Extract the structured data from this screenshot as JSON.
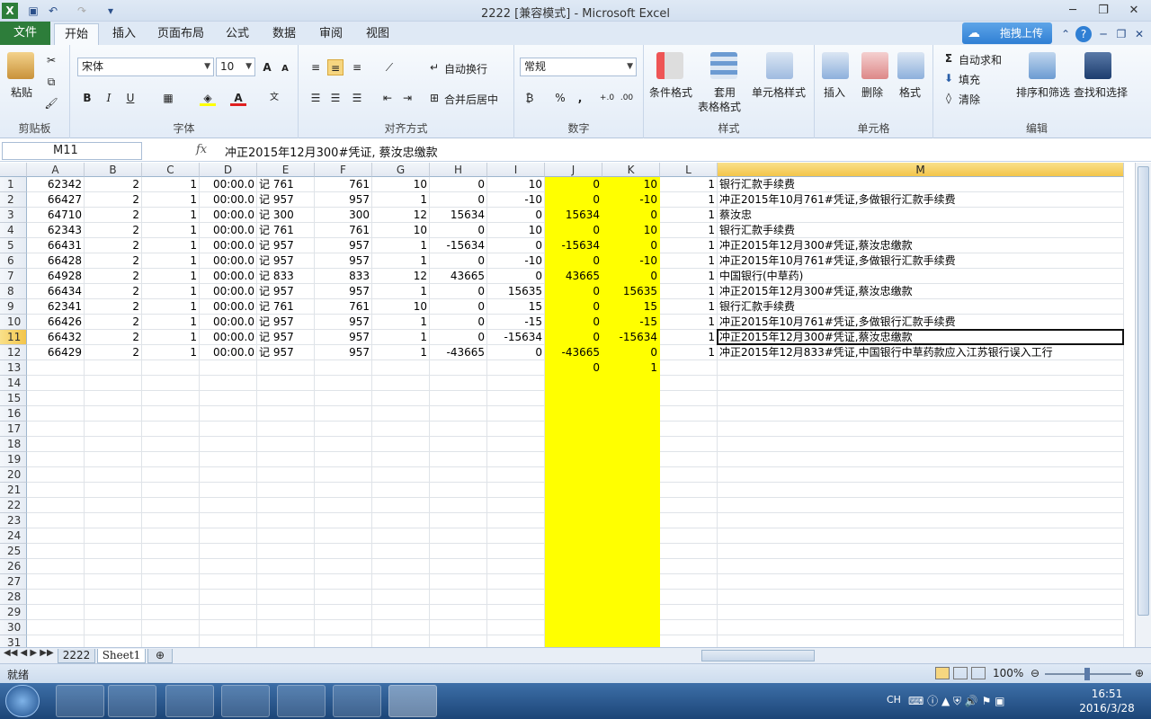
{
  "window": {
    "title": "2222  [兼容模式]  -  Microsoft Excel"
  },
  "tabs": [
    "文件",
    "开始",
    "插入",
    "页面布局",
    "公式",
    "数据",
    "审阅",
    "视图"
  ],
  "upload_button": "拖拽上传",
  "ribbon": {
    "clipboard": {
      "paste": "粘贴",
      "label": "剪贴板"
    },
    "font": {
      "name": "宋体",
      "size": "10",
      "label": "字体",
      "bold": "B",
      "italic": "I",
      "underline": "U"
    },
    "align": {
      "wrap": "自动换行",
      "merge": "合并后居中",
      "label": "对齐方式"
    },
    "number": {
      "format": "常规",
      "label": "数字",
      "percent": "%",
      "comma": ","
    },
    "styles": {
      "cond": "条件格式",
      "table1": "套用",
      "table2": "表格格式",
      "cell": "单元格样式",
      "label": "样式"
    },
    "cells": {
      "insert": "插入",
      "delete": "删除",
      "format": "格式",
      "label": "单元格"
    },
    "editing": {
      "autosum": "自动求和",
      "fill": "填充",
      "clear": "清除",
      "sort": "排序和筛选",
      "find": "查找和选择",
      "label": "编辑"
    }
  },
  "formula_bar": {
    "name_box": "M11",
    "fx": "fx",
    "content": "冲正2015年12月300#凭证, 蔡汝忠缴款"
  },
  "columns": [
    "A",
    "B",
    "C",
    "D",
    "E",
    "F",
    "G",
    "H",
    "I",
    "J",
    "K",
    "L",
    "M"
  ],
  "row_numbers": [
    "1",
    "2",
    "3",
    "4",
    "5",
    "6",
    "7",
    "8",
    "9",
    "10",
    "11",
    "12",
    "13",
    "14",
    "15",
    "16",
    "17",
    "18",
    "19",
    "20",
    "21",
    "22",
    "23",
    "24",
    "25",
    "26",
    "27",
    "28",
    "29",
    "30",
    "31"
  ],
  "rows": [
    [
      "62342",
      "2",
      "1",
      "00:00.0",
      "记 761",
      "761",
      "10",
      "0",
      "10",
      "0",
      "10",
      "1",
      "银行汇款手续费"
    ],
    [
      "66427",
      "2",
      "1",
      "00:00.0",
      "记 957",
      "957",
      "1",
      "0",
      "-10",
      "0",
      "-10",
      "1",
      "冲正2015年10月761#凭证,多做银行汇款手续费"
    ],
    [
      "64710",
      "2",
      "1",
      "00:00.0",
      "记 300",
      "300",
      "12",
      "15634",
      "0",
      "15634",
      "0",
      "1",
      "蔡汝忠"
    ],
    [
      "62343",
      "2",
      "1",
      "00:00.0",
      "记 761",
      "761",
      "10",
      "0",
      "10",
      "0",
      "10",
      "1",
      "银行汇款手续费"
    ],
    [
      "66431",
      "2",
      "1",
      "00:00.0",
      "记 957",
      "957",
      "1",
      "-15634",
      "0",
      "-15634",
      "0",
      "1",
      "冲正2015年12月300#凭证,蔡汝忠缴款"
    ],
    [
      "66428",
      "2",
      "1",
      "00:00.0",
      "记 957",
      "957",
      "1",
      "0",
      "-10",
      "0",
      "-10",
      "1",
      "冲正2015年10月761#凭证,多做银行汇款手续费"
    ],
    [
      "64928",
      "2",
      "1",
      "00:00.0",
      "记 833",
      "833",
      "12",
      "43665",
      "0",
      "43665",
      "0",
      "1",
      "中国银行(中草药)"
    ],
    [
      "66434",
      "2",
      "1",
      "00:00.0",
      "记 957",
      "957",
      "1",
      "0",
      "15635",
      "0",
      "15635",
      "1",
      "冲正2015年12月300#凭证,蔡汝忠缴款"
    ],
    [
      "62341",
      "2",
      "1",
      "00:00.0",
      "记 761",
      "761",
      "10",
      "0",
      "15",
      "0",
      "15",
      "1",
      "银行汇款手续费"
    ],
    [
      "66426",
      "2",
      "1",
      "00:00.0",
      "记 957",
      "957",
      "1",
      "0",
      "-15",
      "0",
      "-15",
      "1",
      "冲正2015年10月761#凭证,多做银行汇款手续费"
    ],
    [
      "66432",
      "2",
      "1",
      "00:00.0",
      "记 957",
      "957",
      "1",
      "0",
      "-15634",
      "0",
      "-15634",
      "1",
      "冲正2015年12月300#凭证,蔡汝忠缴款"
    ],
    [
      "66429",
      "2",
      "1",
      "00:00.0",
      "记 957",
      "957",
      "1",
      "-43665",
      "0",
      "-43665",
      "0",
      "1",
      "冲正2015年12月833#凭证,中国银行中草药款应入江苏银行误入工行"
    ],
    [
      "",
      "",
      "",
      "",
      "",
      "",
      "",
      "",
      "",
      "0",
      "1",
      "",
      ""
    ]
  ],
  "sheets": [
    "2222",
    "Sheet1"
  ],
  "status": {
    "mode": "就绪",
    "zoom": "100%"
  },
  "taskbar": {
    "lang": "CH",
    "time": "16:51",
    "date": "2016/3/28"
  },
  "colors": {
    "highlight": "#ffff00",
    "excel_green": "#2d7d3a"
  }
}
